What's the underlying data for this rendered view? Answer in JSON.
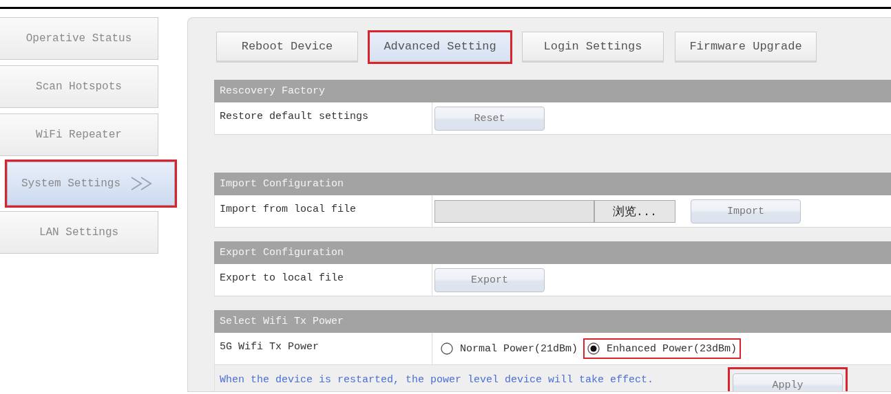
{
  "sidebar": {
    "items": [
      {
        "label": "Operative Status",
        "selected": false,
        "highlighted": false
      },
      {
        "label": "Scan Hotspots",
        "selected": false,
        "highlighted": false
      },
      {
        "label": "WiFi Repeater",
        "selected": false,
        "highlighted": false
      },
      {
        "label": "System Settings",
        "selected": true,
        "highlighted": true
      },
      {
        "label": "LAN Settings",
        "selected": false,
        "highlighted": false
      }
    ]
  },
  "tabs": [
    {
      "label": "Reboot Device",
      "selected": false,
      "highlighted": false
    },
    {
      "label": "Advanced Setting",
      "selected": true,
      "highlighted": true
    },
    {
      "label": "Login Settings",
      "selected": false,
      "highlighted": false
    },
    {
      "label": "Firmware Upgrade",
      "selected": false,
      "highlighted": false
    }
  ],
  "sections": [
    {
      "title": "Rescovery Factory",
      "rows": [
        {
          "kind": "button",
          "label": "Restore default settings",
          "button": "Reset"
        }
      ]
    },
    {
      "title": "Import Configuration",
      "rows": [
        {
          "kind": "file",
          "label": "Import from local file",
          "browse": "浏览...",
          "button": "Import"
        }
      ]
    },
    {
      "title": "Export Configuration",
      "rows": [
        {
          "kind": "button",
          "label": "Export to local file",
          "button": "Export"
        }
      ]
    },
    {
      "title": "Select Wifi Tx Power",
      "rows": [
        {
          "kind": "radio",
          "label": "5G Wifi Tx Power",
          "options": [
            {
              "label": "Normal Power(21dBm)",
              "selected": false,
              "highlighted": false
            },
            {
              "label": "Enhanced Power(23dBm)",
              "selected": true,
              "highlighted": true
            }
          ]
        },
        {
          "kind": "note",
          "text": "When the device is restarted, the power level device will take effect.",
          "button": "Apply",
          "highlighted": true
        }
      ]
    }
  ]
}
